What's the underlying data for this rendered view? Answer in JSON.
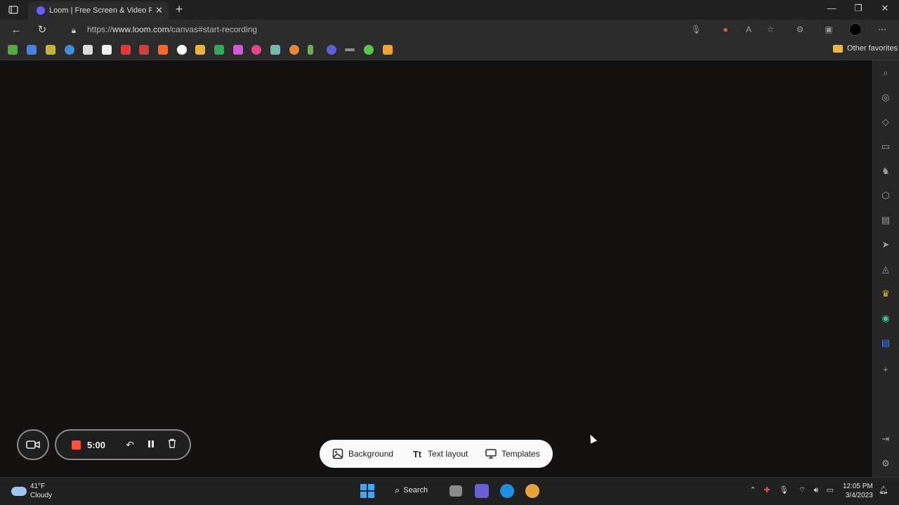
{
  "browser": {
    "tab_title": "Loom | Free Screen & Video Rec",
    "url_prefix": "https://",
    "url_host": "www.loom.com",
    "url_path": "/canvas#start-recording",
    "other_favorites": "Other favorites"
  },
  "loom": {
    "timer": "5:00",
    "toolbar": {
      "background": "Background",
      "text_layout": "Text layout",
      "templates": "Templates"
    }
  },
  "taskbar": {
    "temperature": "41°F",
    "weather": "Cloudy",
    "search": "Search",
    "time": "12:05 PM",
    "date": "3/4/2023"
  },
  "colors": {
    "record_red": "#f2553f",
    "canvas_bg": "#141111",
    "toolbar_bg": "#fafafa"
  }
}
